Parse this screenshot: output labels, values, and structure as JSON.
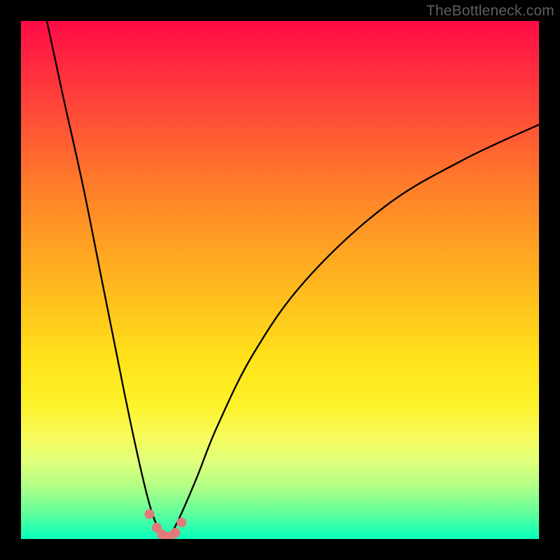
{
  "watermark": "TheBottleneck.com",
  "colors": {
    "page_bg": "#000000",
    "curve": "#000000",
    "dots": "#e17a7a"
  },
  "chart_data": {
    "type": "line",
    "title": "",
    "xlabel": "",
    "ylabel": "",
    "xlim": [
      0,
      100
    ],
    "ylim": [
      0,
      100
    ],
    "grid": false,
    "legend": false,
    "curve_left": {
      "x": [
        5,
        8,
        12,
        16,
        20,
        23,
        25,
        26.5,
        27.5,
        28
      ],
      "y": [
        100,
        86,
        68,
        48,
        28,
        14,
        6,
        2,
        0.5,
        0
      ]
    },
    "curve_right": {
      "x": [
        28,
        29,
        31,
        34,
        38,
        45,
        55,
        70,
        85,
        100
      ],
      "y": [
        0,
        1,
        5,
        12,
        22,
        36,
        50,
        64,
        73,
        80
      ]
    },
    "dots": [
      {
        "x": 24.8,
        "y": 4.8
      },
      {
        "x": 26.2,
        "y": 2.2
      },
      {
        "x": 27.2,
        "y": 0.9
      },
      {
        "x": 28.0,
        "y": 0.5
      },
      {
        "x": 28.8,
        "y": 0.5
      },
      {
        "x": 29.8,
        "y": 1.2
      },
      {
        "x": 31.0,
        "y": 3.2
      }
    ]
  }
}
